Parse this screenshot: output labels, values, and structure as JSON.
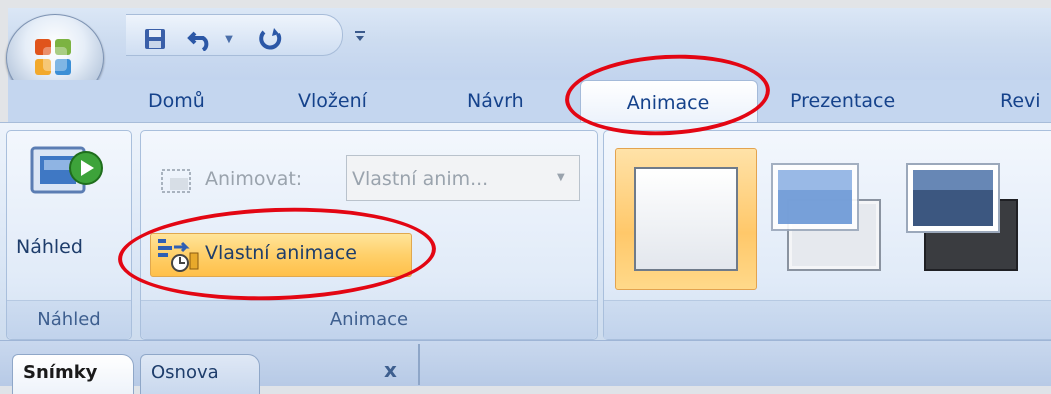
{
  "quick_access": {
    "save_icon": "save-icon",
    "undo_icon": "undo-icon",
    "undo_dropdown_icon": "chevron-down-icon",
    "redo_icon": "redo-icon",
    "customize_icon": "customize-qat-icon"
  },
  "tabs": [
    {
      "label": "Domů"
    },
    {
      "label": "Vložení"
    },
    {
      "label": "Návrh"
    },
    {
      "label": "Animace",
      "active": true
    },
    {
      "label": "Prezentace"
    },
    {
      "label": "Revi"
    }
  ],
  "ribbon": {
    "preview_group": {
      "button_label": "Náhled",
      "group_label": "Náhled"
    },
    "animation_group": {
      "animate_label": "Animovat:",
      "animate_value": "Vlastní anim...",
      "custom_animation_label": "Vlastní animace",
      "group_label": "Animace"
    }
  },
  "slide_panel": {
    "tabs": [
      "Snímky",
      "Osnova"
    ],
    "close_label": "x"
  },
  "colors": {
    "highlight_circle": "#e30613",
    "tab_text": "#15428b"
  }
}
